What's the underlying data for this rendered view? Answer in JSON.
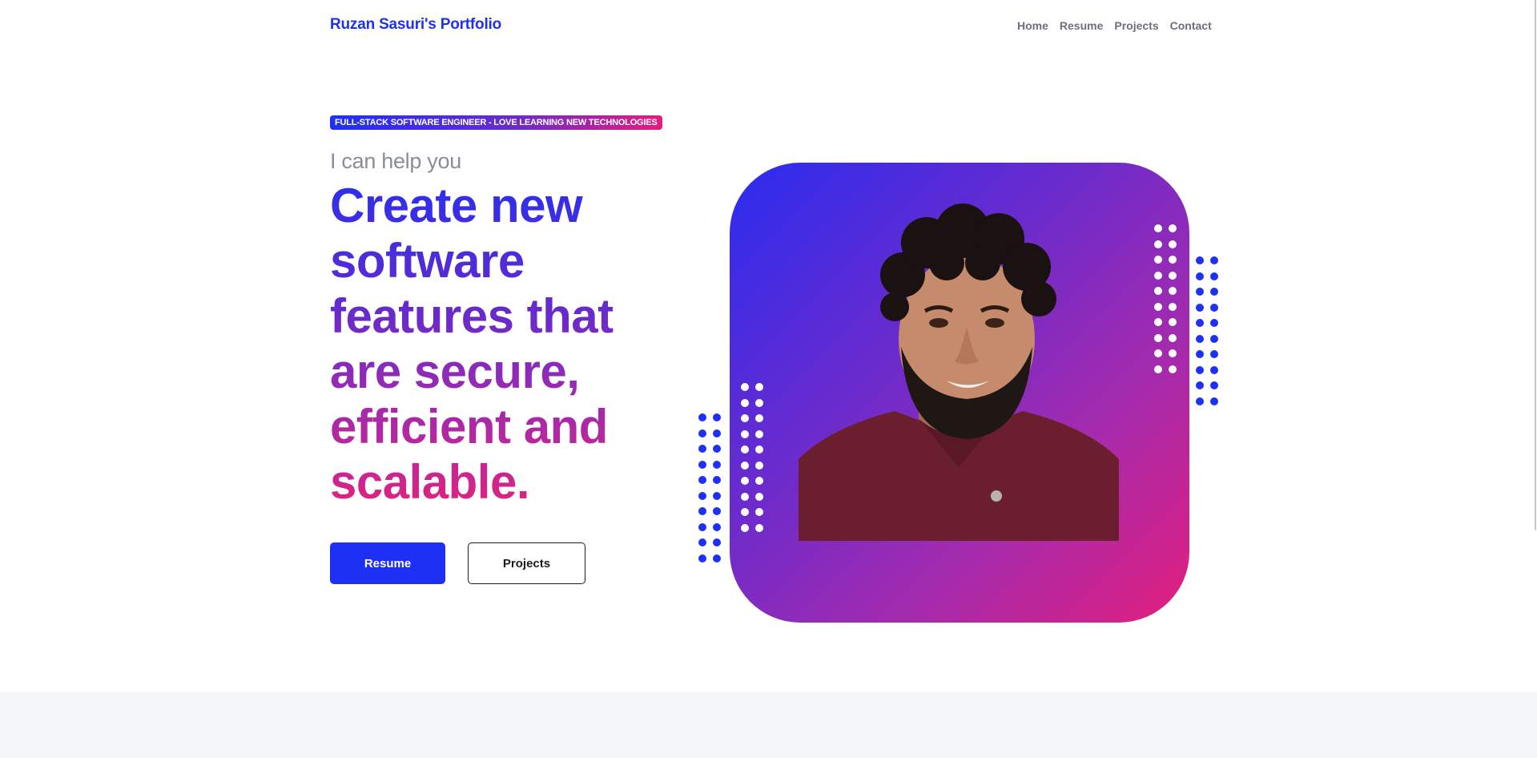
{
  "nav": {
    "brand": "Ruzan Sasuri's Portfolio",
    "links": [
      "Home",
      "Resume",
      "Projects",
      "Contact"
    ]
  },
  "hero": {
    "tag": "FULL-STACK SOFTWARE ENGINEER - LOVE LEARNING NEW TECHNOLOGIES",
    "intro": "I can help you",
    "headline_lines": [
      "Create new",
      "software",
      "features that",
      "are secure,",
      "efficient and",
      "scalable."
    ],
    "buttons": {
      "primary": "Resume",
      "secondary": "Projects"
    }
  },
  "image": {
    "alt": "Portrait photo",
    "gradient": [
      "#2a2cf0",
      "#6a2bcd",
      "#a32bae",
      "#e21f7d"
    ]
  },
  "colors": {
    "accent": "#1e30f3",
    "pink": "#e21e80",
    "text_muted": "#8a8d99"
  }
}
